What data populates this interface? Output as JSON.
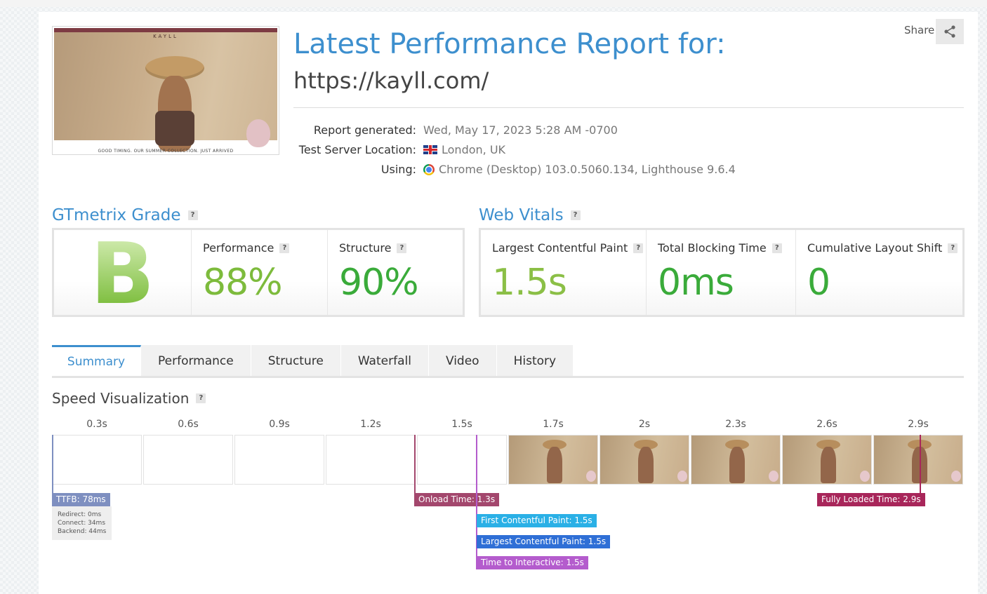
{
  "report": {
    "title": "Latest Performance Report for:",
    "url": "https://kayll.com/",
    "share_label": "Share",
    "generated_label": "Report generated:",
    "generated_value": "Wed, May 17, 2023 5:28 AM -0700",
    "location_label": "Test Server Location:",
    "location_value": "London, UK",
    "using_label": "Using:",
    "using_value": "Chrome (Desktop) 103.0.5060.134, Lighthouse 9.6.4",
    "thumbnail_brand": "KAYLL",
    "thumbnail_caption": "GOOD TIMING. OUR SUMMER COLLECTION. JUST ARRIVED"
  },
  "grade": {
    "heading": "GTmetrix Grade",
    "letter": "B",
    "performance_label": "Performance",
    "performance_value": "88%",
    "structure_label": "Structure",
    "structure_value": "90%"
  },
  "vitals": {
    "heading": "Web Vitals",
    "lcp_label": "Largest Contentful Paint",
    "lcp_value": "1.5s",
    "tbt_label": "Total Blocking Time",
    "tbt_value": "0ms",
    "cls_label": "Cumulative Layout Shift",
    "cls_value": "0"
  },
  "tabs": [
    "Summary",
    "Performance",
    "Structure",
    "Waterfall",
    "Video",
    "History"
  ],
  "speed": {
    "heading": "Speed Visualization",
    "times": [
      "0.3s",
      "0.6s",
      "0.9s",
      "1.2s",
      "1.5s",
      "1.7s",
      "2s",
      "2.3s",
      "2.6s",
      "2.9s"
    ],
    "ttfb": "TTFB: 78ms",
    "redirect": "Redirect: 0ms",
    "connect": "Connect: 34ms",
    "backend": "Backend: 44ms",
    "onload": "Onload Time: 1.3s",
    "fcp": "First Contentful Paint: 1.5s",
    "lcp": "Largest Contentful Paint: 1.5s",
    "tti": "Time to Interactive: 1.5s",
    "fully_loaded": "Fully Loaded Time: 2.9s"
  },
  "colors": {
    "accent": "#3d8fce",
    "grade_green": "#8dc63f",
    "ttfb": "#7e8fc0",
    "onload": "#a3476d",
    "fcp": "#2ab0e6",
    "lcp": "#2f6fd6",
    "tti": "#b45ccd",
    "fully_loaded": "#a8265a"
  },
  "icons": {
    "share": "share-icon",
    "flag": "uk-flag-icon",
    "browser": "chrome-icon",
    "help": "help-icon"
  }
}
